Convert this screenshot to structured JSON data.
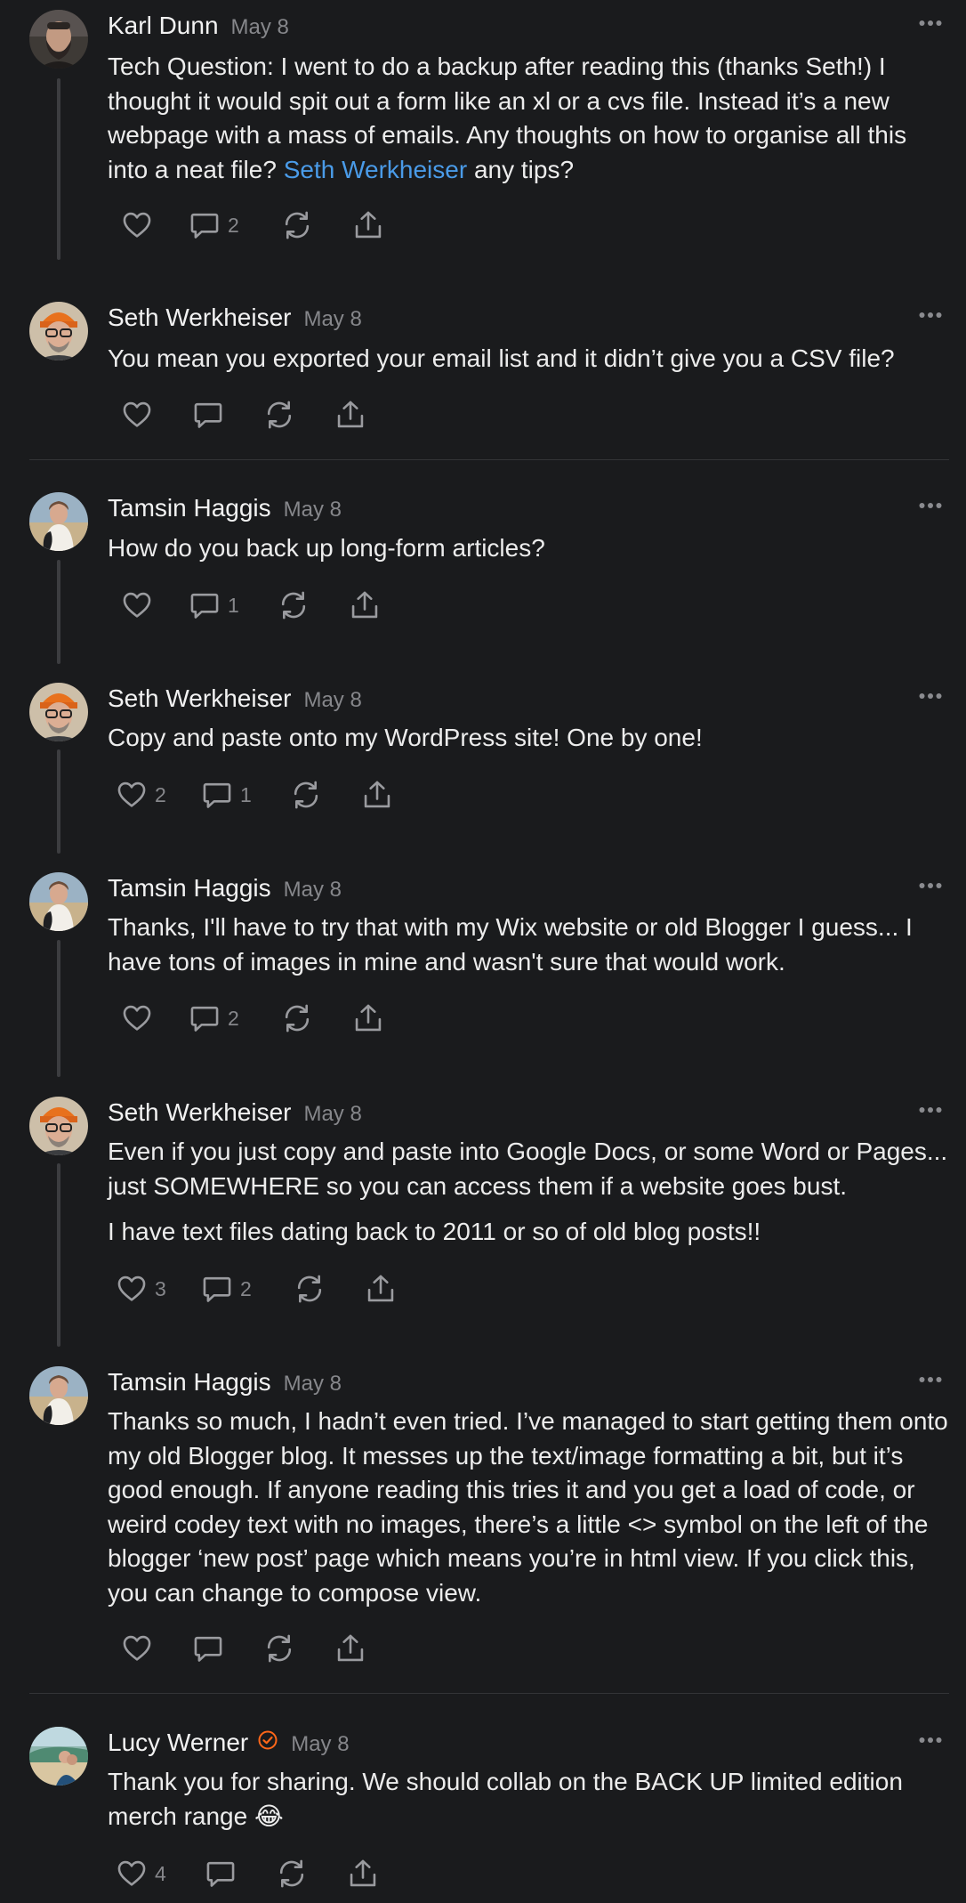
{
  "posts": [
    {
      "author": "Karl Dunn",
      "date": "May 8",
      "avatar": "avatar-bearded-man",
      "text": [
        "Tech Question: I went to do a backup after reading this (thanks Seth!) I thought it would spit out a form like an xl or a cvs file. Instead it’s a new webpage with a mass of emails. Any thoughts on how to organise all this into a neat file?"
      ],
      "mention": "Seth Werkheiser",
      "text_after_mention": " any tips?",
      "likes": "",
      "comments": "2"
    },
    {
      "author": "Seth Werkheiser",
      "date": "May 8",
      "avatar": "avatar-orange-beanie",
      "text": [
        "You mean you exported your email list and it didn’t give you a CSV file?"
      ],
      "likes": "",
      "comments": ""
    },
    {
      "author": "Tamsin Haggis",
      "date": "May 8",
      "avatar": "avatar-beach-woman",
      "text": [
        "How do you back up long-form articles?"
      ],
      "likes": "",
      "comments": "1"
    },
    {
      "author": "Seth Werkheiser",
      "date": "May 8",
      "avatar": "avatar-orange-beanie",
      "text": [
        "Copy and paste onto my WordPress site! One by one!"
      ],
      "likes": "2",
      "comments": "1"
    },
    {
      "author": "Tamsin Haggis",
      "date": "May 8",
      "avatar": "avatar-beach-woman",
      "text": [
        "Thanks, I'll have to try that with my Wix website or old Blogger I guess... I have tons of images in mine and wasn't sure that would work."
      ],
      "likes": "",
      "comments": "2"
    },
    {
      "author": "Seth Werkheiser",
      "date": "May 8",
      "avatar": "avatar-orange-beanie",
      "text": [
        "Even if you just copy and paste into Google Docs, or some Word or Pages... just SOMEWHERE so you can access them if a website goes bust.",
        "I have text files dating back to 2011 or so of old blog posts!!"
      ],
      "likes": "3",
      "comments": "2"
    },
    {
      "author": "Tamsin Haggis",
      "date": "May 8",
      "avatar": "avatar-beach-woman",
      "text": [
        "Thanks so much, I hadn’t even tried. I’ve managed to start getting them onto my old Blogger blog. It messes up the text/image formatting a bit, but it’s good enough. If anyone reading this tries it and you get a load of code, or weird codey text with no images, there’s a little <> symbol on the left of the blogger ‘new post’ page which means you’re in html view. If you click this, you can change to compose view."
      ],
      "likes": "",
      "comments": ""
    },
    {
      "author": "Lucy Werner",
      "date": "May 8",
      "avatar": "avatar-beach-couple",
      "verified": true,
      "text": [
        "Thank you for sharing. We should collab on the BACK UP limited edition merch range 😂"
      ],
      "likes": "4",
      "comments": ""
    }
  ],
  "icons": {
    "like": "heart-icon",
    "comment": "comment-icon",
    "restack": "restack-icon",
    "share": "share-icon",
    "more": "more-dots-icon",
    "verified": "verified-badge-icon"
  },
  "colors": {
    "background": "#1a1b1d",
    "text": "#ececec",
    "muted": "#86878b",
    "link": "#4a9be8",
    "verified": "#ff6719"
  }
}
